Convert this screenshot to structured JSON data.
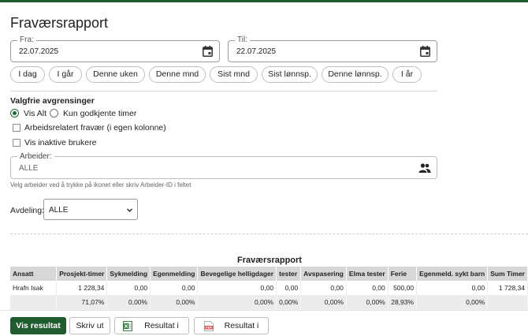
{
  "page": {
    "title": "Fraværsrapport"
  },
  "dates": {
    "from": {
      "label": "Fra:",
      "value": "22.07.2025"
    },
    "to": {
      "label": "Til:",
      "value": "22.07.2025"
    }
  },
  "quick_ranges": [
    "I dag",
    "I går",
    "Denne uken",
    "Denne mnd",
    "Sist mnd",
    "Sist lønnsp.",
    "Denne lønnsp.",
    "I år"
  ],
  "filters": {
    "heading": "Valgfrie avgrensinger",
    "radio_all": "Vis Alt",
    "radio_approved": "Kun godkjente timer",
    "check_work_related": "Arbeidsrelatert fravær (i egen kolonne)",
    "check_inactive": "Vis inaktive brukere",
    "worker": {
      "label": "Arbeider:",
      "value": "ALLE",
      "hint": "Velg arbeider ved å trykke på ikonet eller skriv Arbeider-ID i feltet"
    },
    "department": {
      "label": "Avdeling:",
      "value": "ALLE"
    }
  },
  "report": {
    "title": "Fraværsrapport",
    "columns": [
      "Ansatt",
      "Prosjekt-timer",
      "Sykmelding",
      "Egenmelding",
      "Bevegelige helligdager",
      "tester",
      "Avspasering",
      "Elma tester",
      "Ferie",
      "Egenmeld. sykt barn",
      "Sum Timer"
    ],
    "rows": [
      [
        "Hrafn Isak",
        "1 228,34",
        "0,00",
        "0,00",
        "0,00",
        "0,00",
        "0,00",
        "0,00",
        "500,00",
        "0,00",
        "1 728,34"
      ],
      [
        "",
        "71,07%",
        "0,00%",
        "0,00%",
        "0,00%",
        "0,00%",
        "0,00%",
        "0,00%",
        "28,93%",
        "0,00%",
        ""
      ]
    ]
  },
  "actions": {
    "show": "Vis resultat",
    "print": "Skriv ut",
    "excel": "Resultat i Excel",
    "pdf": "Resultat i PDF"
  },
  "colors": {
    "brand_green": "#1f5c2e",
    "radio_green": "#1e6b34"
  },
  "icons": {
    "date_picker": "calendar-icon",
    "worker_picker": "people-icon",
    "excel": "excel-file-icon",
    "pdf": "pdf-file-icon",
    "select": "chevron-down-icon"
  }
}
